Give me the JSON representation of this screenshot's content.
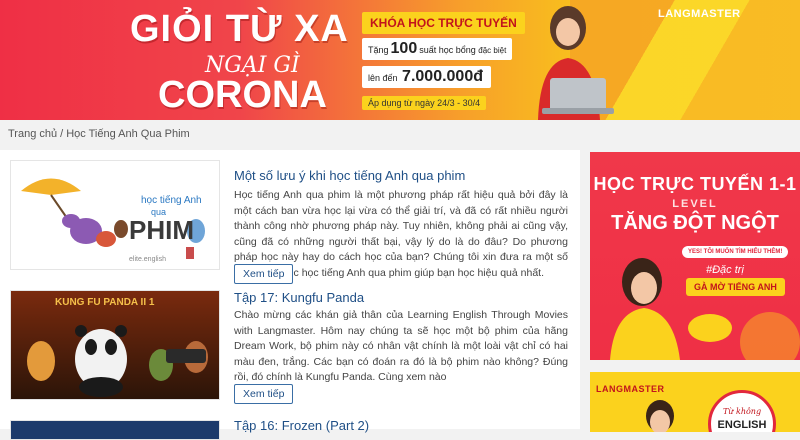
{
  "banner": {
    "line1": "GIỎI TỪ XA",
    "line2": "NGẠI GÌ",
    "line3": "CORONA",
    "course_label": "KHÓA HỌC TRỰC TUYẾN",
    "offer_prefix": "Tặng",
    "offer_number": "100",
    "offer_suffix_1": "suất học bổng",
    "offer_suffix_2": "đặc biệt",
    "value_prefix": "lên đến",
    "value_amount": "7.000.000đ",
    "date_text": "Áp dụng từ ngày 24/3 - 30/4",
    "brand": "LANGMASTER"
  },
  "breadcrumb": {
    "home": "Trang chủ",
    "separator": "/",
    "current": "Học Tiếng Anh Qua Phim"
  },
  "articles": [
    {
      "title": "Một số lưu ý khi học tiếng Anh qua phim",
      "description": "Học tiếng Anh qua phim là một phương pháp rất hiệu quả bởi đây là một cách ban vừa học lại vừa có thể giải trí, và đã có rất nhiều người thành công nhờ phương pháp này. Tuy nhiên, không phải ai cũng vậy, cũng đã có những người thất bại, vậy lý do là do đâu? Do phương pháp học này hay do cách học của bạn? Chúng tôi xin đưa ra một số lưu ý cho việc học tiếng Anh qua phim giúp bạn học hiệu quả nhất.",
      "button": "Xem tiếp",
      "thumb_text_top": "học tiếng Anh",
      "thumb_text_main": "PHIM",
      "thumb_text_sub": "qua",
      "thumb_footer": "elite.english"
    },
    {
      "title": "Tập 17: Kungfu Panda",
      "description": "Chào mừng các khán giả thân của Learning English Through Movies with Langmaster. Hôm nay chúng ta sẽ học một bộ phim của hãng Dream Work, bộ phim này có nhân vật chính là một loài vật chỉ có hai màu đen, trắng. Các bạn có đoán ra đó là bộ phim nào không? Đúng rồi, đó chính là Kungfu Panda. Cùng xem nào",
      "button": "Xem tiếp",
      "thumb_text": "KUNG FU PANDA II 1"
    },
    {
      "title": "Tập 16: Frozen (Part 2)"
    }
  ],
  "sidebar": {
    "ad1_line1": "HỌC TRỰC TUYẾN 1-1",
    "ad1_line2": "LEVEL",
    "ad1_line3": "TĂNG ĐỘT NGỘT",
    "ad1_pill": "YES! TÔI MUỐN TÌM HIỂU THÊM!",
    "ad1_tag": "#Đặc trị",
    "ad1_go": "GÀ MỜ TIẾNG ANH",
    "ad2_brand": "LANGMASTER",
    "ad2_badge_1": "Từ không",
    "ad2_badge_2": "ENGLISH"
  },
  "colors": {
    "banner_red": "#ef2f45",
    "banner_yellow": "#fbd21d",
    "link_blue": "#1f4f86"
  }
}
